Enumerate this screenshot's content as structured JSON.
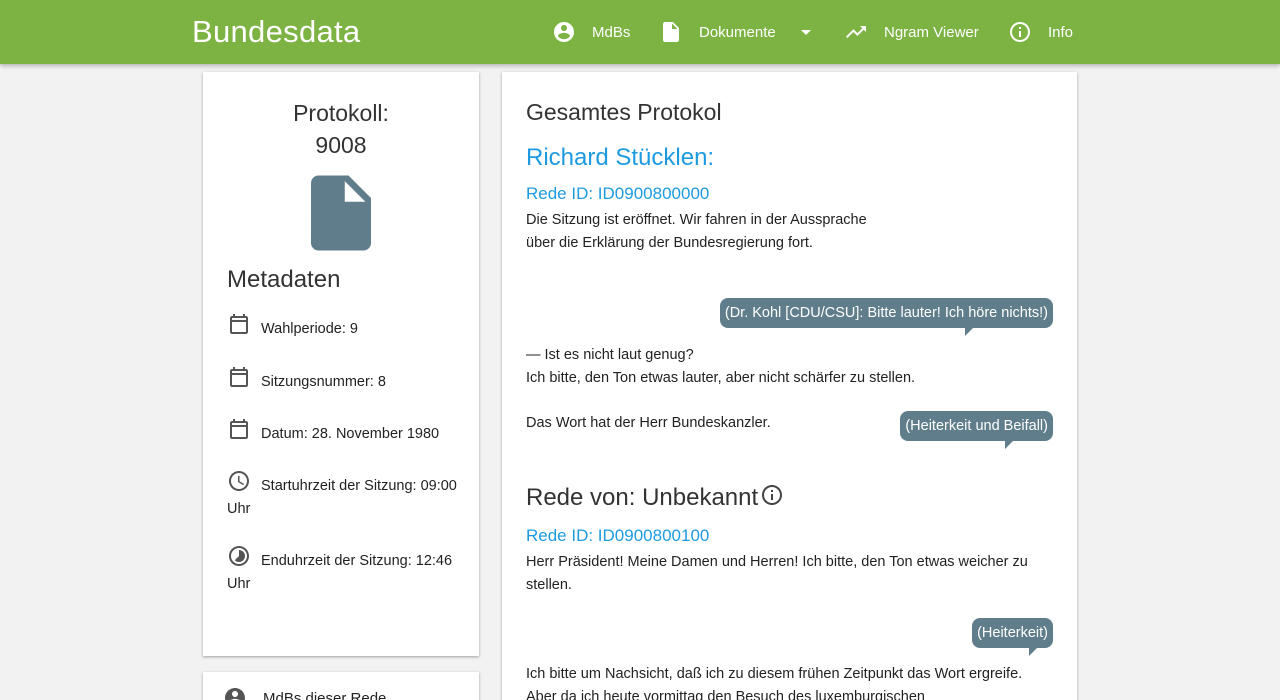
{
  "header": {
    "brand": "Bundesdata",
    "nav": {
      "mdbs": "MdBs",
      "dokumente": "Dokumente",
      "ngram": "Ngram Viewer",
      "info": "Info"
    }
  },
  "protocol": {
    "title_line1": "Protokoll:",
    "title_line2": "9008",
    "meta_heading": "Metadaten",
    "wahlperiode": "Wahlperiode: 9",
    "sitzungsnummer": "Sitzungsnummer: 8",
    "datum": "Datum: 28. November 1980",
    "startuhrzeit": "Startuhrzeit der Sitzung: 09:00 Uhr",
    "enduhrzeit": "Enduhrzeit der Sitzung: 12:46 Uhr"
  },
  "sidebar_bottom": {
    "mdbs_label": "MdBs dieser Rede"
  },
  "content": {
    "heading": "Gesamtes Protokol",
    "speech1": {
      "speaker": "Richard Stücklen:",
      "rede_id": "Rede ID: ID0900800000",
      "para1": "Die Sitzung ist eröffnet. Wir fahren in der Aussprache über die Erklärung der Bundesregierung fort.",
      "comment1": "(Dr. Kohl [CDU/CSU]: Bitte lauter! Ich höre nichts!)",
      "para2_line1": "— Ist es nicht laut genug?",
      "para2_line2": "Ich bitte, den Ton etwas lauter, aber nicht schärfer zu stellen.",
      "para3": "Das Wort hat der Herr Bundeskanzler.",
      "comment2": "(Heiterkeit und Beifall)"
    },
    "speech2": {
      "heading": "Rede von: Unbekannt",
      "rede_id": "Rede ID: ID0900800100",
      "para1": "Herr Präsident! Meine Damen und Herren! Ich bitte, den Ton etwas weicher zu stellen.",
      "comment1": "(Heiterkeit)",
      "para2": "Ich bitte um Nachsicht, daß ich zu diesem frühen Zeitpunkt das Wort ergreife. Aber da ich heute vormittag den Besuch des luxemburgischen"
    }
  }
}
